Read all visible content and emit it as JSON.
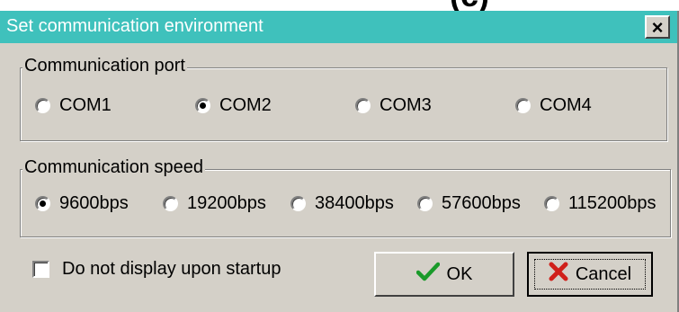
{
  "top_fragment": "(c)",
  "dialog": {
    "title": "Set communication environment",
    "close_label": "×"
  },
  "port_group": {
    "legend": "Communication port",
    "options": [
      "COM1",
      "COM2",
      "COM3",
      "COM4"
    ],
    "selected": "COM2"
  },
  "speed_group": {
    "legend": "Communication speed",
    "options": [
      "9600bps",
      "19200bps",
      "38400bps",
      "57600bps",
      "115200bps"
    ],
    "selected": "9600bps"
  },
  "startup_checkbox": {
    "label": "Do not display upon startup",
    "checked": false
  },
  "buttons": {
    "ok_label": "OK",
    "cancel_label": "Cancel"
  },
  "colors": {
    "titlebar": "#3fc1bc",
    "face": "#d4d0c8",
    "ok_icon": "#1a9a2a",
    "cancel_icon": "#d0201a"
  },
  "icons": {
    "ok": "checkmark-icon",
    "cancel": "x-icon"
  }
}
